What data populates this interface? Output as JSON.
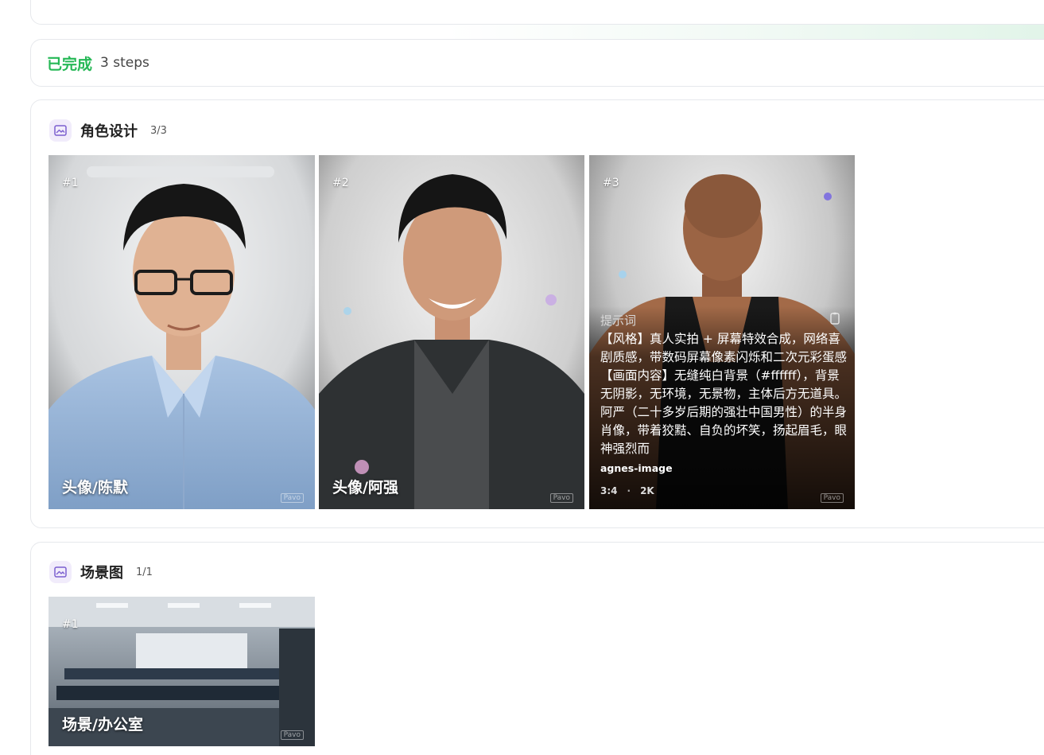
{
  "status": {
    "label": "已完成",
    "steps": "3 steps"
  },
  "characters": {
    "title": "角色设计",
    "count": "3/3",
    "items": [
      {
        "num": "#1",
        "caption": "头像/陈默",
        "watermark": "Pavo"
      },
      {
        "num": "#2",
        "caption": "头像/阿强",
        "watermark": "Pavo"
      },
      {
        "num": "#3",
        "prompt_label": "提示词",
        "prompt": "【风格】真人实拍 + 屏幕特效合成，网络喜剧质感，带数码屏幕像素闪烁和二次元彩蛋感 【画面内容】无缝纯白背景（#ffffff），背景无阴影，无环境，无景物，主体后方无道具。阿严（二十多岁后期的强壮中国男性）的半身肖像，带着狡黠、自负的坏笑，扬起眉毛，眼神强烈而",
        "model": "agnes-image",
        "ratio": "3:4",
        "resolution": "2K",
        "watermark": "Pavo"
      }
    ]
  },
  "scenes": {
    "title": "场景图",
    "count": "1/1",
    "items": [
      {
        "num": "#1",
        "caption": "场景/办公室",
        "watermark": "Pavo"
      }
    ]
  },
  "colors": {
    "done": "#26b856",
    "section_icon": "#7b5fcf",
    "card_border": "#e6e8ec"
  },
  "icons": {
    "section": "image-icon",
    "copy": "copy-icon"
  }
}
